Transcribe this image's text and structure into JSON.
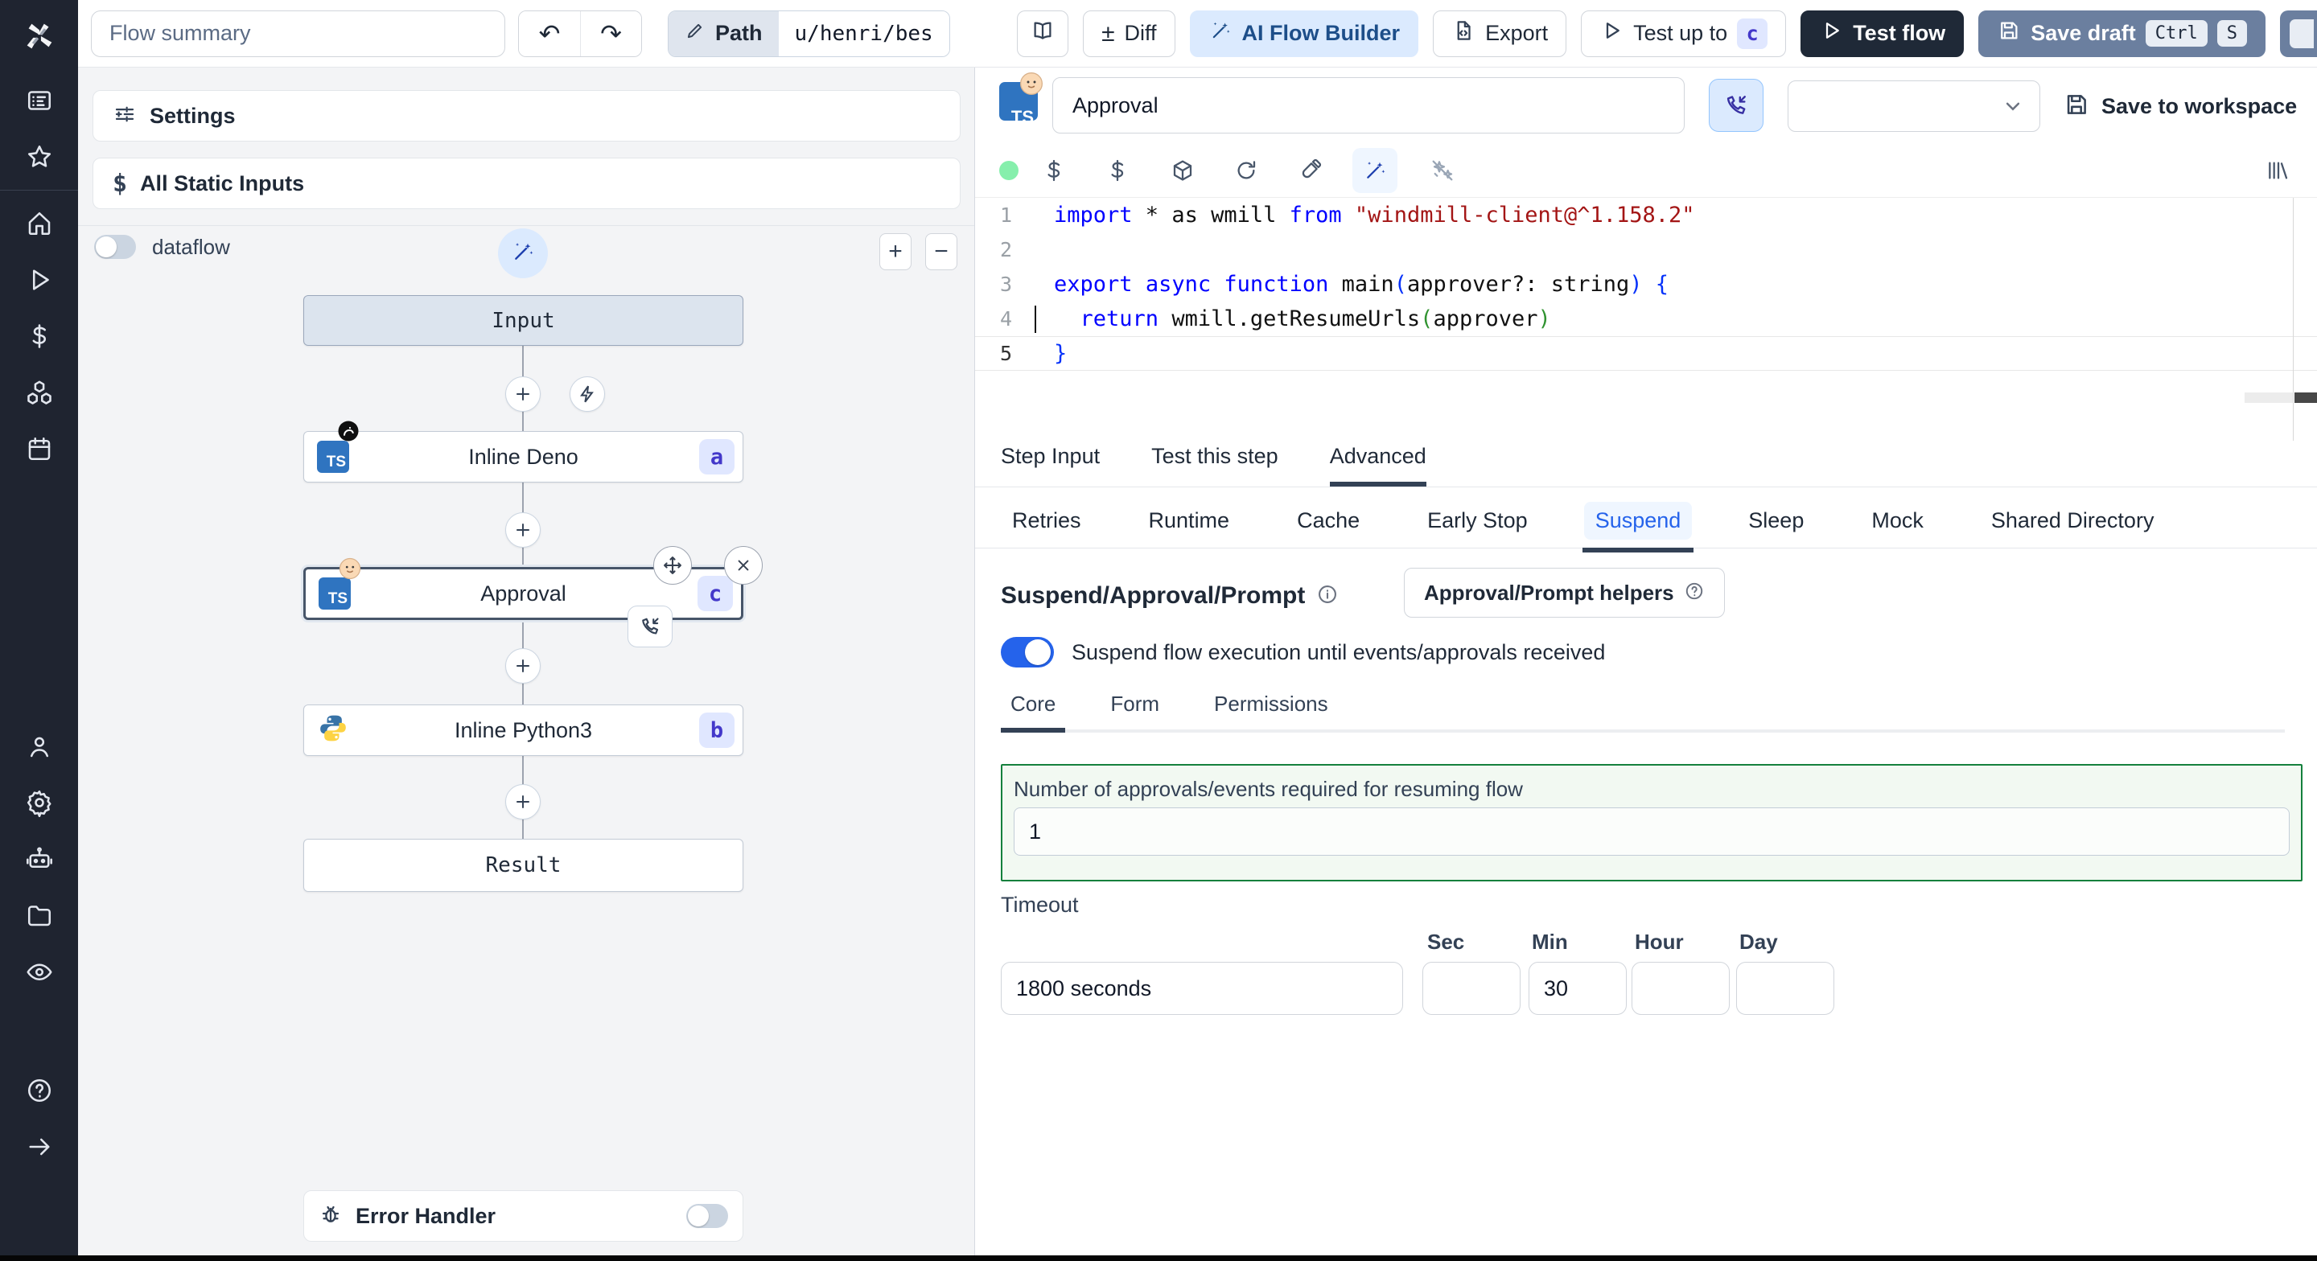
{
  "topbar": {
    "flow_summary_value": "Flow summary",
    "path_label": "Path",
    "path_value": "u/henri/bes",
    "diff_symbol": "±",
    "diff_label": "Diff",
    "ai_flow_builder_label": "AI Flow Builder",
    "export_label": "Export",
    "test_up_to_label": "Test up to",
    "test_up_to_badge": "c",
    "test_flow_label": "Test flow",
    "save_draft_label": "Save draft",
    "kbd_ctrl": "Ctrl",
    "kbd_s": "S"
  },
  "sidebar": {
    "icons": [
      "apps",
      "favorites",
      "home",
      "runs",
      "variables",
      "resources",
      "schedules",
      "users",
      "settings",
      "workers",
      "folders",
      "logs",
      "help",
      "expand"
    ]
  },
  "left_panel": {
    "settings_label": "Settings",
    "all_static_inputs_label": "All Static Inputs",
    "dataflow_label": "dataflow",
    "zoom_in_label": "+",
    "zoom_out_label": "−",
    "error_handler_label": "Error Handler"
  },
  "graph": {
    "ts_label": "TS",
    "input_label": "Input",
    "result_label": "Result",
    "nodes": [
      {
        "label": "Inline Deno",
        "badge": "a"
      },
      {
        "label": "Approval",
        "badge": "c"
      },
      {
        "label": "Inline Python3",
        "badge": "b"
      }
    ]
  },
  "editor": {
    "name_value": "Approval",
    "save_to_workspace_label": "Save to workspace",
    "code": {
      "lines": [
        {
          "n": "1",
          "tokens": [
            {
              "t": "import",
              "c": "kw"
            },
            {
              "t": " * as wmill ",
              "c": "pl"
            },
            {
              "t": "from",
              "c": "kw"
            },
            {
              "t": " ",
              "c": "pl"
            },
            {
              "t": "\"windmill-client@^1.158.2\"",
              "c": "str"
            }
          ]
        },
        {
          "n": "2",
          "tokens": []
        },
        {
          "n": "3",
          "tokens": [
            {
              "t": "export",
              "c": "kw"
            },
            {
              "t": " ",
              "c": "pl"
            },
            {
              "t": "async",
              "c": "kw"
            },
            {
              "t": " ",
              "c": "pl"
            },
            {
              "t": "function",
              "c": "kw"
            },
            {
              "t": " main",
              "c": "pl"
            },
            {
              "t": "(",
              "c": "pb"
            },
            {
              "t": "approver?: string",
              "c": "pl"
            },
            {
              "t": ") {",
              "c": "pb"
            }
          ]
        },
        {
          "n": "4",
          "tokens": [
            {
              "t": "  ",
              "c": "pl"
            },
            {
              "t": "return",
              "c": "kw"
            },
            {
              "t": " wmill.getResumeUrls",
              "c": "pl"
            },
            {
              "t": "(",
              "c": "pg"
            },
            {
              "t": "approver",
              "c": "pl"
            },
            {
              "t": ")",
              "c": "pg"
            }
          ]
        },
        {
          "n": "5",
          "tokens": [
            {
              "t": "}",
              "c": "pb"
            }
          ]
        }
      ]
    }
  },
  "tabs": {
    "items": [
      {
        "label": "Step Input"
      },
      {
        "label": "Test this step"
      },
      {
        "label": "Advanced"
      }
    ],
    "active": "Advanced"
  },
  "subtabs": {
    "items": [
      {
        "label": "Retries"
      },
      {
        "label": "Runtime"
      },
      {
        "label": "Cache"
      },
      {
        "label": "Early Stop"
      },
      {
        "label": "Suspend"
      },
      {
        "label": "Sleep"
      },
      {
        "label": "Mock"
      },
      {
        "label": "Shared Directory"
      }
    ],
    "active": "Suspend"
  },
  "suspend": {
    "title": "Suspend/Approval/Prompt",
    "helpers_label": "Approval/Prompt helpers",
    "toggle_label": "Suspend flow execution until events/approvals received",
    "inner_tabs": [
      {
        "label": "Core"
      },
      {
        "label": "Form"
      },
      {
        "label": "Permissions"
      }
    ],
    "active_inner_tab": "Core",
    "approvals_label": "Number of approvals/events required for resuming flow",
    "approvals_value": "1",
    "timeout_label": "Timeout",
    "timeout_value": "1800 seconds",
    "units": [
      {
        "label": "Sec",
        "value": ""
      },
      {
        "label": "Min",
        "value": "30"
      },
      {
        "label": "Hour",
        "value": ""
      },
      {
        "label": "Day",
        "value": ""
      }
    ]
  },
  "colors": {
    "accent_blue": "#2563eb",
    "approval_box_green": "#15803d",
    "badge_bg": "#e0e7ff",
    "badge_text": "#4338ca",
    "ai_button_bg": "#dbeafe",
    "save_draft_bg": "#6b7f9f",
    "test_flow_bg": "#1f2937",
    "sidebar_bg": "#1f2430"
  }
}
